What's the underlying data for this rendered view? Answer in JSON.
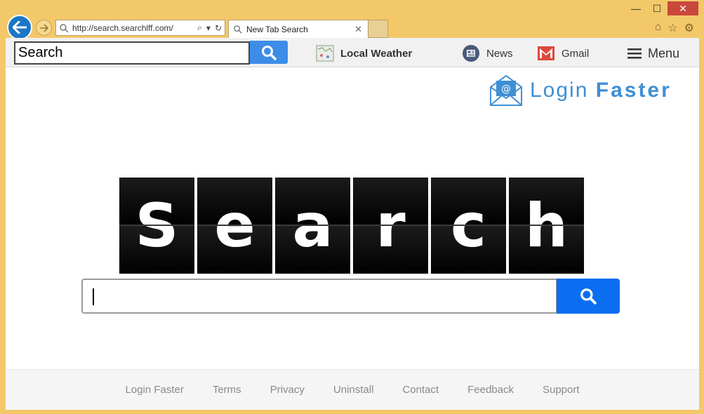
{
  "browser": {
    "address_url": "http://search.searchlff.com/",
    "tab_title": "New Tab Search",
    "window_controls": {
      "minimize_icon": "minimize-icon",
      "maximize_icon": "maximize-icon",
      "close_icon": "close-icon"
    },
    "right_icons": [
      "home-icon",
      "star-icon",
      "gear-icon"
    ]
  },
  "toolbar": {
    "search_value": "Search",
    "weather_label": "Local Weather",
    "news_label": "News",
    "gmail_label": "Gmail",
    "menu_label": "Menu"
  },
  "brand": {
    "word1": "Login",
    "word2": "Faster"
  },
  "hero": {
    "letters": [
      "S",
      "e",
      "a",
      "r",
      "c",
      "h"
    ]
  },
  "footer": {
    "links": [
      "Login Faster",
      "Terms",
      "Privacy",
      "Uninstall",
      "Contact",
      "Feedback",
      "Support"
    ]
  },
  "colors": {
    "frame": "#f3c869",
    "toolbar_button": "#3d8de8",
    "main_search_button": "#0b6ef0",
    "brand": "#3f8fd4"
  }
}
